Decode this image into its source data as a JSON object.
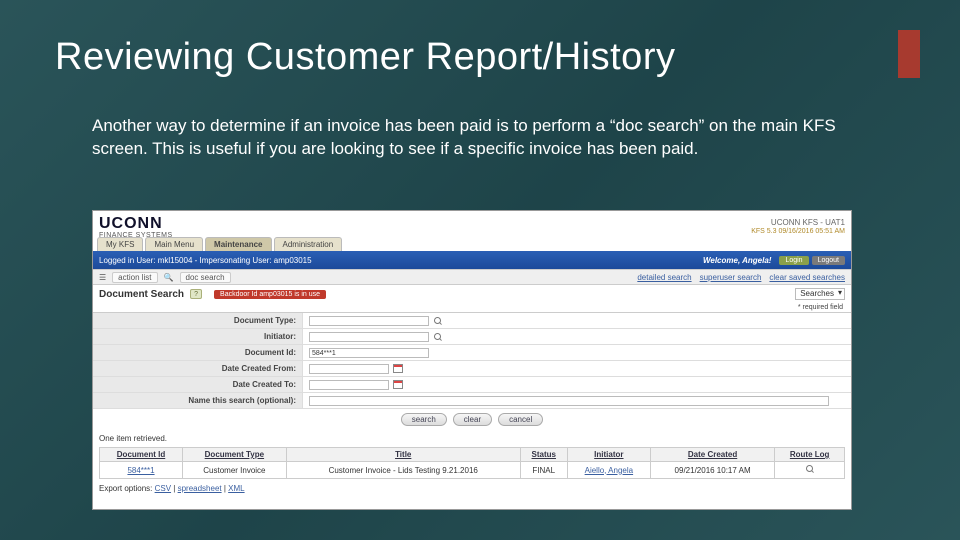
{
  "slide": {
    "title": "Reviewing Customer Report/History",
    "body": "Another way to determine if an invoice has been paid is to perform a “doc search” on the main KFS screen.  This is useful if you are looking to see if a specific invoice has been paid."
  },
  "brand": {
    "name": "UCONN",
    "sub": "FINANCE SYSTEMS",
    "env": "UCONN KFS - UAT1",
    "timestamp": "KFS 5.3 09/16/2016 05:51 AM"
  },
  "tabs": [
    "My KFS",
    "Main Menu",
    "Maintenance",
    "Administration"
  ],
  "tabs_active_index": 2,
  "banner": {
    "logged_in": "Logged in User: mkl15004 - Impersonating User: amp03015",
    "welcome": "Welcome, Angela!",
    "btn_login": "Login",
    "btn_logout": "Logout"
  },
  "action_strip": {
    "action_list": "action list",
    "doc_search": "doc search",
    "links": [
      "detailed search",
      "superuser search",
      "clear saved searches"
    ]
  },
  "docsearch": {
    "title": "Document Search",
    "help": "?",
    "backdoor": "Backdoor Id amp03015 is in use",
    "searches_label": "Searches"
  },
  "required_note": "* required field",
  "form_labels": {
    "doc_type": "Document Type:",
    "initiator": "Initiator:",
    "doc_id": "Document Id:",
    "date_from": "Date Created From:",
    "date_to": "Date Created To:",
    "name_search": "Name this search (optional):"
  },
  "form_values": {
    "doc_id": "584***1"
  },
  "actions": {
    "search": "search",
    "clear": "clear",
    "cancel": "cancel"
  },
  "results_note": "One item retrieved.",
  "results": {
    "headers": [
      "Document Id",
      "Document Type",
      "Title",
      "Status",
      "Initiator",
      "Date Created",
      "Route Log"
    ],
    "row": {
      "doc_id": "584***1",
      "doc_type": "Customer Invoice",
      "title": "Customer Invoice - Lids Testing 9.21.2016",
      "status": "FINAL",
      "initiator": "Aiello, Angela",
      "date_created": "09/21/2016 10:17 AM",
      "route_log_icon": "route-log-icon"
    }
  },
  "export": {
    "prefix": "Export options: ",
    "links": [
      "CSV",
      "spreadsheet",
      "XML"
    ]
  }
}
